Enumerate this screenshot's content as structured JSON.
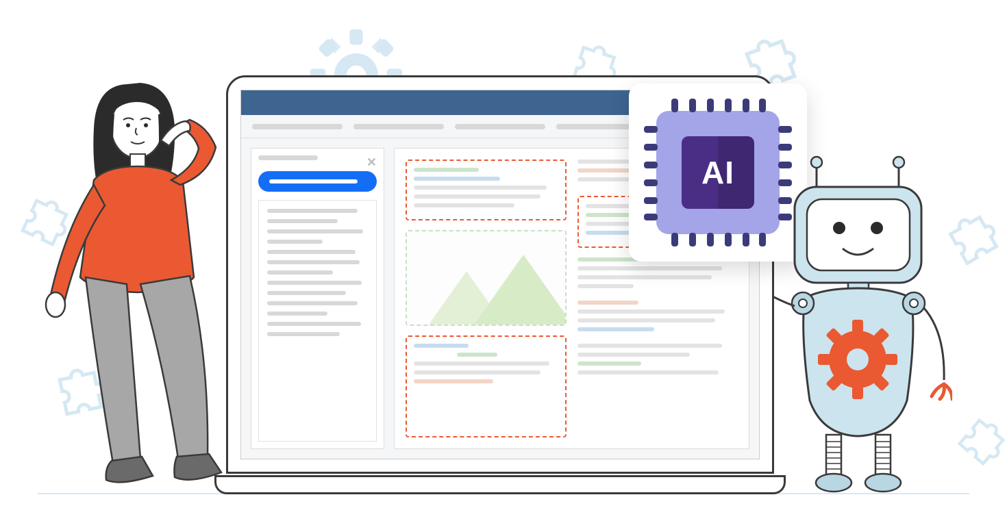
{
  "chip": {
    "label": "AI"
  },
  "colors": {
    "brand_blue": "#146ef5",
    "accent_orange": "#ea5932",
    "navy": "#3e6490",
    "chip_purple": "#4a2e85",
    "chip_light": "#a4a4e8",
    "robot_blue": "#cce4ee",
    "puzzle": "#d5e8f3"
  },
  "decorations": {
    "puzzle_pieces_count": 6,
    "background_gear": true,
    "ground_line": true
  },
  "characters": {
    "woman": {
      "shirt_color": "#ea5932",
      "pants_color": "#a7a7a7",
      "hair_color": "#2b2b2b"
    },
    "robot": {
      "body_color": "#cce4ee",
      "gear_color": "#ea5932"
    }
  },
  "laptop": {
    "tabs_count": 5,
    "sidebar": {
      "has_close": true,
      "has_primary_button": true,
      "text_lines": 13
    },
    "content": {
      "highlighted_blocks": 3,
      "image_placeholder": true
    }
  }
}
